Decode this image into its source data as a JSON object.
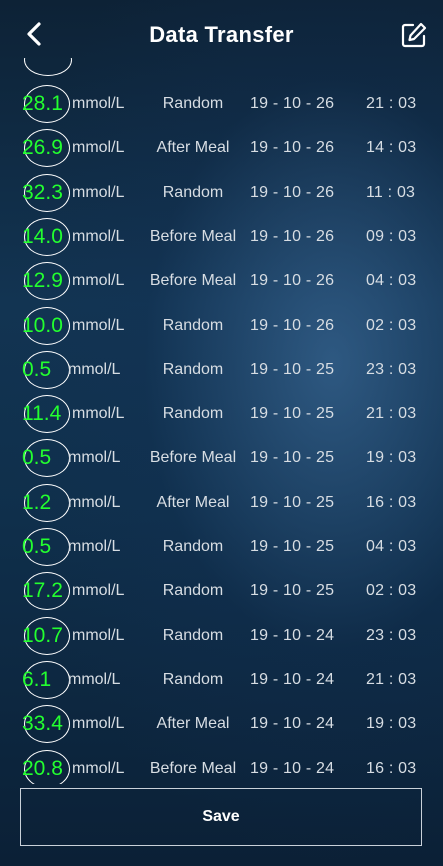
{
  "header": {
    "title": "Data Transfer",
    "back_icon": "chevron-left-icon",
    "edit_icon": "edit-icon"
  },
  "records": [
    {
      "value": "28.1",
      "unit": "mmol/L",
      "meal": "Random",
      "date": "19 - 10 - 26",
      "time": "21 : 03"
    },
    {
      "value": "26.9",
      "unit": "mmol/L",
      "meal": "After Meal",
      "date": "19 - 10 - 26",
      "time": "14 : 03"
    },
    {
      "value": "32.3",
      "unit": "mmol/L",
      "meal": "Random",
      "date": "19 - 10 - 26",
      "time": "11 : 03"
    },
    {
      "value": "14.0",
      "unit": "mmol/L",
      "meal": "Before Meal",
      "date": "19 - 10 - 26",
      "time": "09 : 03"
    },
    {
      "value": "12.9",
      "unit": "mmol/L",
      "meal": "Before Meal",
      "date": "19 - 10 - 26",
      "time": "04 : 03"
    },
    {
      "value": "10.0",
      "unit": "mmol/L",
      "meal": "Random",
      "date": "19 - 10 - 26",
      "time": "02 : 03"
    },
    {
      "value": "0.5",
      "unit": "mmol/L",
      "meal": "Random",
      "date": "19 - 10 - 25",
      "time": "23 : 03"
    },
    {
      "value": "11.4",
      "unit": "mmol/L",
      "meal": "Random",
      "date": "19 - 10 - 25",
      "time": "21 : 03"
    },
    {
      "value": "0.5",
      "unit": "mmol/L",
      "meal": "Before Meal",
      "date": "19 - 10 - 25",
      "time": "19 : 03"
    },
    {
      "value": "1.2",
      "unit": "mmol/L",
      "meal": "After Meal",
      "date": "19 - 10 - 25",
      "time": "16 : 03"
    },
    {
      "value": "0.5",
      "unit": "mmol/L",
      "meal": "Random",
      "date": "19 - 10 - 25",
      "time": "04 : 03"
    },
    {
      "value": "17.2",
      "unit": "mmol/L",
      "meal": "Random",
      "date": "19 - 10 - 25",
      "time": "02 : 03"
    },
    {
      "value": "10.7",
      "unit": "mmol/L",
      "meal": "Random",
      "date": "19 - 10 - 24",
      "time": "23 : 03"
    },
    {
      "value": "6.1",
      "unit": "mmol/L",
      "meal": "Random",
      "date": "19 - 10 - 24",
      "time": "21 : 03"
    },
    {
      "value": "33.4",
      "unit": "mmol/L",
      "meal": "After Meal",
      "date": "19 - 10 - 24",
      "time": "19 : 03"
    },
    {
      "value": "20.8",
      "unit": "mmol/L",
      "meal": "Before Meal",
      "date": "19 - 10 - 24",
      "time": "16 : 03"
    }
  ],
  "footer": {
    "save_label": "Save"
  },
  "colors": {
    "value_text": "#23ff2f",
    "accent_border": "#ffffff"
  }
}
